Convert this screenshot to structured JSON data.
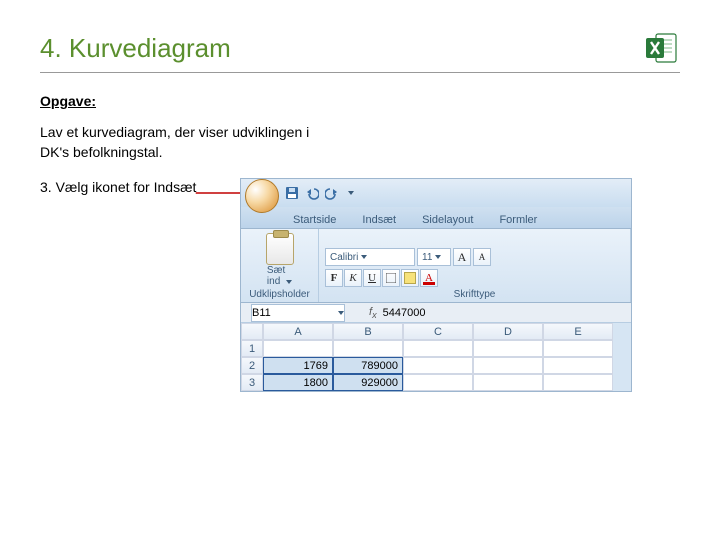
{
  "title": "4. Kurvediagram",
  "subtitle": "Opgave:",
  "task_text": "Lav et kurvediagram, der viser udviklingen i DK's befolkningstal.",
  "step_text": "3. Vælg ikonet for Indsæt",
  "excel": {
    "tabs": {
      "home": "Startside",
      "insert": "Indsæt",
      "layout": "Sidelayout",
      "formulas": "Formler"
    },
    "ribbon": {
      "paste_label": "Sæt",
      "paste_sub": "ind",
      "clipboard_group": "Udklipsholder",
      "font_group": "Skrifttype",
      "font_name": "Calibri",
      "font_size": "11",
      "aa_grow": "A",
      "aa_shrink": "A",
      "bold": "F",
      "italic": "K",
      "underline": "U",
      "color_a": "A"
    },
    "namebox": "B11",
    "fx_value": "5447000",
    "col_headers": [
      "A",
      "B",
      "C",
      "D",
      "E"
    ],
    "rows": [
      {
        "n": "1",
        "a": "",
        "b": ""
      },
      {
        "n": "2",
        "a": "1769",
        "b": "789000"
      },
      {
        "n": "3",
        "a": "1800",
        "b": "929000"
      }
    ]
  }
}
